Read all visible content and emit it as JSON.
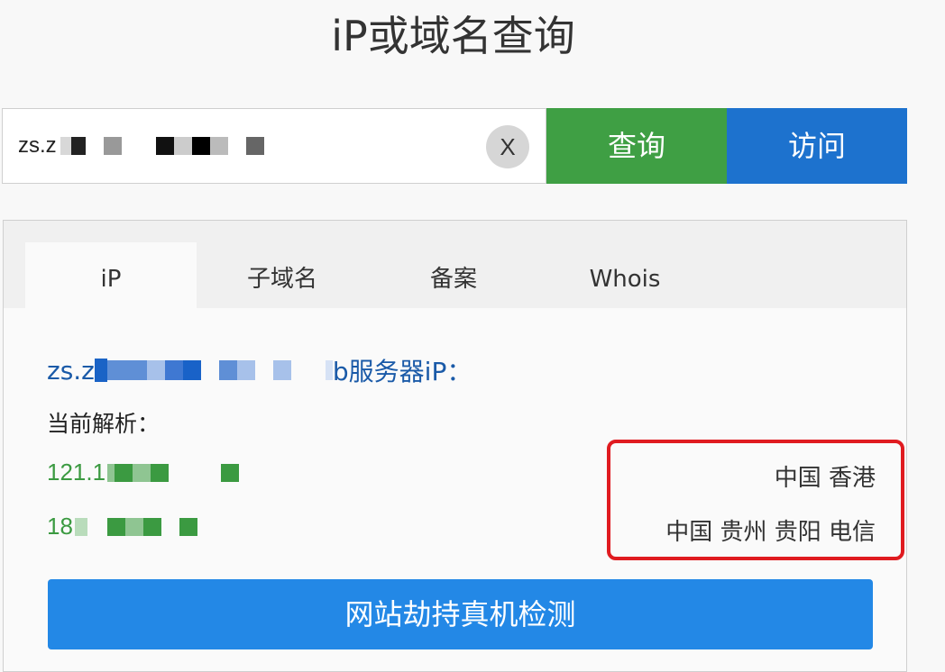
{
  "page": {
    "title": "iP或域名查询"
  },
  "search": {
    "value_prefix": "zs.z",
    "clear_label": "X",
    "query_label": "查询",
    "visit_label": "访问"
  },
  "tabs": [
    {
      "label": "iP",
      "active": true
    },
    {
      "label": "子域名",
      "active": false
    },
    {
      "label": "备案",
      "active": false
    },
    {
      "label": "Whois",
      "active": false
    }
  ],
  "result": {
    "server_prefix": "zs.z",
    "server_suffix": "b服务器iP：",
    "current_label": "当前解析：",
    "ips": [
      {
        "prefix": "121.1",
        "location": "中国 香港"
      },
      {
        "prefix": "18",
        "location": "中国 贵州 贵阳 电信"
      }
    ]
  },
  "detect_button": {
    "label": "网站劫持真机检测"
  },
  "colors": {
    "query_green": "#3f9f44",
    "visit_blue": "#1d72ce",
    "detect_blue": "#2388e6",
    "ip_green": "#3b9a41",
    "highlight_red": "#e01b20"
  }
}
